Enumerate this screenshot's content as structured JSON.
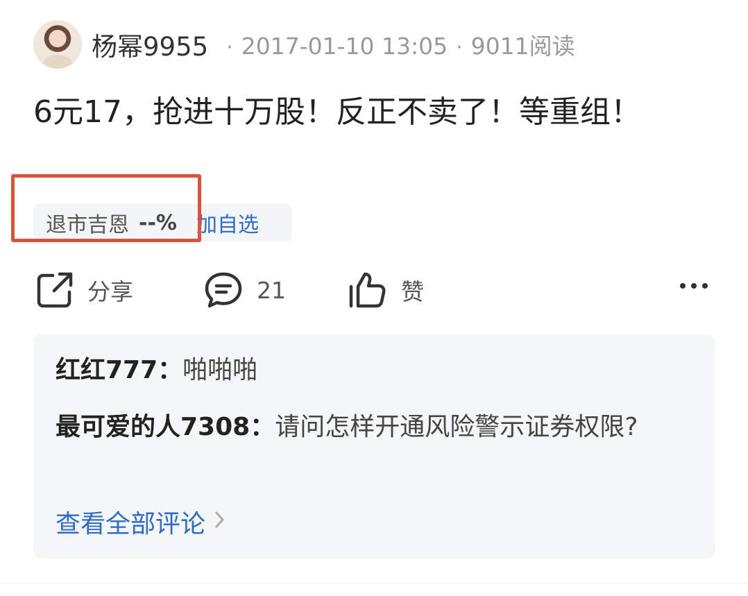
{
  "post": {
    "author": "杨幂9955",
    "separator": "·",
    "timestamp": "2017-01-10 13:05",
    "read_count": "9011阅读",
    "title": "6元17，抢进十万股！反正不卖了！等重组！"
  },
  "stock": {
    "name": "退市吉恩",
    "change": "--%",
    "add_watch_label": "加自选"
  },
  "actions": {
    "share_label": "分享",
    "comment_count": "21",
    "like_label": "赞"
  },
  "comments": [
    {
      "user": "红红777",
      "text": "啪啪啪"
    },
    {
      "user": "最可爱的人7308",
      "text": "请问怎样开通风险警示证券权限?"
    }
  ],
  "comment_colon": "：",
  "view_all_label": "查看全部评论",
  "icons": {
    "avatar": "avatar-image",
    "share": "share-icon",
    "comment": "comment-bubble-icon",
    "like": "thumbs-up-icon",
    "more": "more-dots-icon",
    "chevron": "chevron-right-icon"
  },
  "colors": {
    "link": "#2f6cc4",
    "highlight": "#d9533d",
    "meta": "#999999",
    "panel": "#f5f6f8"
  }
}
